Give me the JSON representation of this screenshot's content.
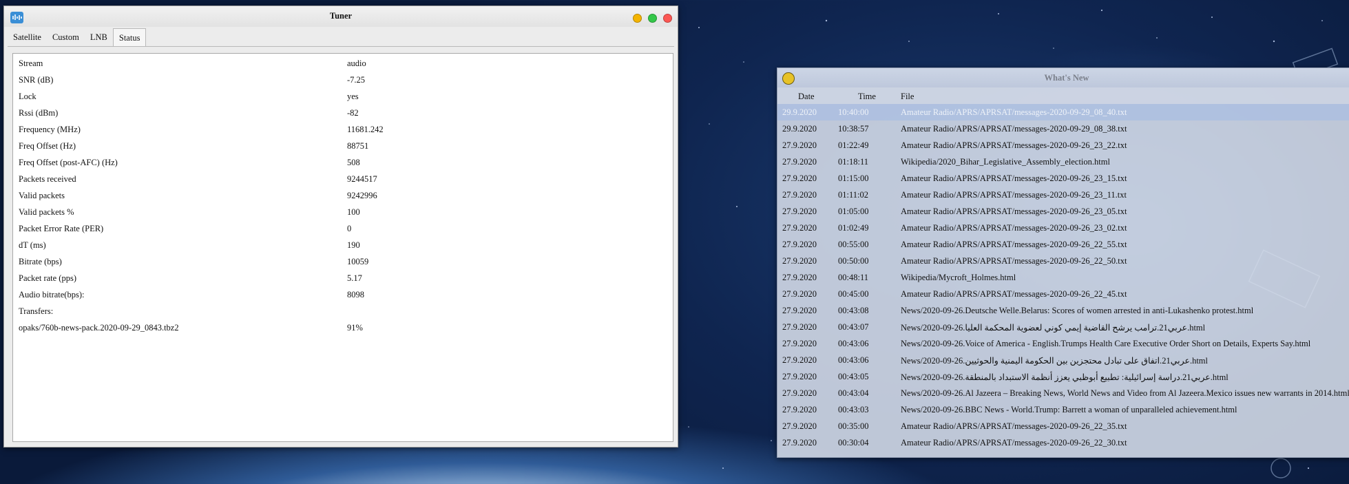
{
  "tuner": {
    "title": "Tuner",
    "tabs": [
      "Satellite",
      "Custom",
      "LNB",
      "Status"
    ],
    "active_tab": "Status",
    "status": [
      {
        "key": "Stream",
        "value": "audio"
      },
      {
        "key": "SNR (dB)",
        "value": "-7.25"
      },
      {
        "key": "Lock",
        "value": "yes"
      },
      {
        "key": "Rssi (dBm)",
        "value": "-82"
      },
      {
        "key": "Frequency (MHz)",
        "value": "11681.242"
      },
      {
        "key": "Freq Offset (Hz)",
        "value": "88751"
      },
      {
        "key": "Freq Offset (post-AFC) (Hz)",
        "value": "508"
      },
      {
        "key": "Packets received",
        "value": "9244517"
      },
      {
        "key": "Valid packets",
        "value": "9242996"
      },
      {
        "key": "Valid packets %",
        "value": "100"
      },
      {
        "key": "Packet Error Rate (PER)",
        "value": "0"
      },
      {
        "key": "dT (ms)",
        "value": "190"
      },
      {
        "key": "Bitrate (bps)",
        "value": "10059"
      },
      {
        "key": "Packet rate (pps)",
        "value": "5.17"
      },
      {
        "key": "Audio bitrate(bps):",
        "value": "8098"
      },
      {
        "key": "Transfers:",
        "value": ""
      },
      {
        "key": "opaks/760b-news-pack.2020-09-29_0843.tbz2",
        "value": "91%"
      }
    ]
  },
  "whatsnew": {
    "title": "What's New",
    "columns": {
      "date": "Date",
      "time": "Time",
      "file": "File"
    },
    "rows": [
      {
        "date": "29.9.2020",
        "time": "10:40:00",
        "file": "Amateur Radio/APRS/APRSAT/messages-2020-09-29_08_40.txt",
        "selected": true
      },
      {
        "date": "29.9.2020",
        "time": "10:38:57",
        "file": "Amateur Radio/APRS/APRSAT/messages-2020-09-29_08_38.txt"
      },
      {
        "date": "27.9.2020",
        "time": "01:22:49",
        "file": "Amateur Radio/APRS/APRSAT/messages-2020-09-26_23_22.txt"
      },
      {
        "date": "27.9.2020",
        "time": "01:18:11",
        "file": "Wikipedia/2020_Bihar_Legislative_Assembly_election.html"
      },
      {
        "date": "27.9.2020",
        "time": "01:15:00",
        "file": "Amateur Radio/APRS/APRSAT/messages-2020-09-26_23_15.txt"
      },
      {
        "date": "27.9.2020",
        "time": "01:11:02",
        "file": "Amateur Radio/APRS/APRSAT/messages-2020-09-26_23_11.txt"
      },
      {
        "date": "27.9.2020",
        "time": "01:05:00",
        "file": "Amateur Radio/APRS/APRSAT/messages-2020-09-26_23_05.txt"
      },
      {
        "date": "27.9.2020",
        "time": "01:02:49",
        "file": "Amateur Radio/APRS/APRSAT/messages-2020-09-26_23_02.txt"
      },
      {
        "date": "27.9.2020",
        "time": "00:55:00",
        "file": "Amateur Radio/APRS/APRSAT/messages-2020-09-26_22_55.txt"
      },
      {
        "date": "27.9.2020",
        "time": "00:50:00",
        "file": "Amateur Radio/APRS/APRSAT/messages-2020-09-26_22_50.txt"
      },
      {
        "date": "27.9.2020",
        "time": "00:48:11",
        "file": "Wikipedia/Mycroft_Holmes.html"
      },
      {
        "date": "27.9.2020",
        "time": "00:45:00",
        "file": "Amateur Radio/APRS/APRSAT/messages-2020-09-26_22_45.txt"
      },
      {
        "date": "27.9.2020",
        "time": "00:43:08",
        "file": "News/2020-09-26.Deutsche Welle.Belarus: Scores of women arrested in anti-Lukashenko protest.html"
      },
      {
        "date": "27.9.2020",
        "time": "00:43:07",
        "file": "News/2020-09-26.عربي21.ترامب يرشح القاضية إيمي كوني لعضوية المحكمة العليا.html"
      },
      {
        "date": "27.9.2020",
        "time": "00:43:06",
        "file": "News/2020-09-26.Voice of America - English.Trumps Health Care Executive Order Short on Details, Experts Say.html"
      },
      {
        "date": "27.9.2020",
        "time": "00:43:06",
        "file": "News/2020-09-26.عربي21.اتفاق على تبادل محتجزين بين الحكومة اليمنية والحوثيين.html"
      },
      {
        "date": "27.9.2020",
        "time": "00:43:05",
        "file": "News/2020-09-26.عربي21.دراسة إسرائيلية: تطبيع أبوظبي يعزز أنظمة الاستبداد بالمنطقة.html"
      },
      {
        "date": "27.9.2020",
        "time": "00:43:04",
        "file": "News/2020-09-26.Al Jazeera – Breaking News, World News and Video from Al Jazeera.Mexico issues new warrants in 2014.html"
      },
      {
        "date": "27.9.2020",
        "time": "00:43:03",
        "file": "News/2020-09-26.BBC News - World.Trump: Barrett a woman of unparalleled achievement.html"
      },
      {
        "date": "27.9.2020",
        "time": "00:35:00",
        "file": "Amateur Radio/APRS/APRSAT/messages-2020-09-26_22_35.txt"
      },
      {
        "date": "27.9.2020",
        "time": "00:30:04",
        "file": "Amateur Radio/APRS/APRSAT/messages-2020-09-26_22_30.txt"
      }
    ]
  },
  "colors": {
    "btn_minimize": "#f4b400",
    "btn_maximize": "#34c749",
    "btn_close": "#fc5753"
  }
}
